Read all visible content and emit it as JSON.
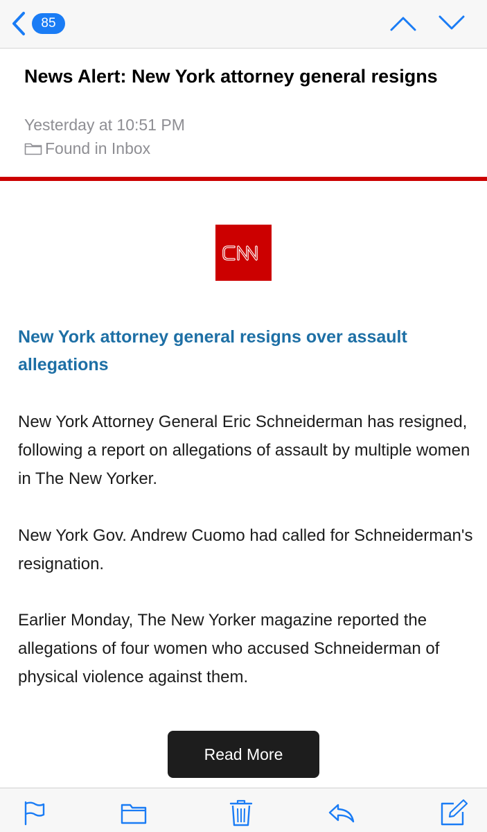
{
  "nav": {
    "badge_count": "85",
    "accent_color": "#1a7cf5",
    "icons": [
      "chevron-left-icon",
      "chevron-up-icon",
      "chevron-down-icon"
    ]
  },
  "message": {
    "subject": "News Alert: New York attorney general resigns",
    "timestamp": "Yesterday at 10:51 PM",
    "location": "Found in Inbox"
  },
  "email": {
    "brand_logo_text": "CNN",
    "brand_color": "#cc0000",
    "headline": "New York attorney general resigns over assault allegations",
    "paragraphs": [
      "New York Attorney General Eric Schneiderman has resigned, following a report on allegations of assault by multiple women in The New Yorker.",
      "New York Gov. Andrew Cuomo had called for Schneiderman's resignation.",
      "Earlier Monday, The New Yorker magazine reported the allegations of four women who accused Schneiderman of physical violence against them."
    ],
    "read_more_label": "Read More"
  },
  "toolbar": {
    "icons": [
      "flag-icon",
      "folder-icon",
      "trash-icon",
      "reply-icon",
      "compose-icon"
    ]
  }
}
